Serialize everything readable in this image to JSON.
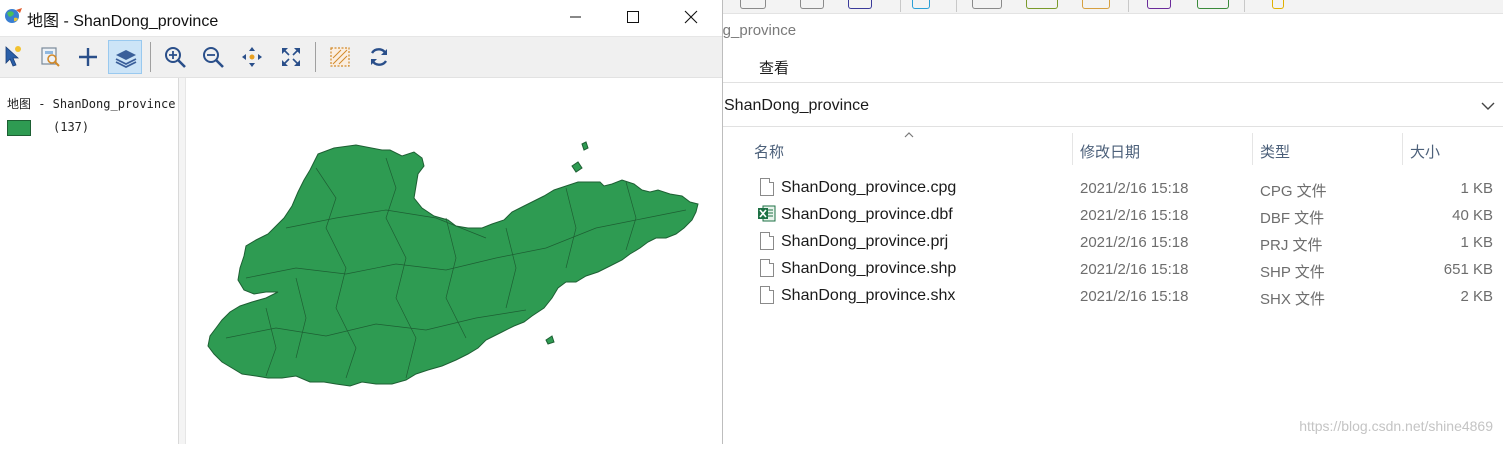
{
  "map_window": {
    "title": "地图 - ShanDong_province",
    "toolbar": [
      "select-tool",
      "identify-tool",
      "add-tool",
      "layers-tool",
      "zoom-in-tool",
      "zoom-out-tool",
      "pan-tool",
      "full-extent-tool",
      "clear-selection-tool",
      "refresh-tool"
    ],
    "legend": {
      "title": "地图 - ShanDong_province",
      "count": "(137)",
      "fill_color": "#2e9b52",
      "stroke_color": "#1d5f33"
    }
  },
  "explorer": {
    "title_fragment": "ong_province",
    "ribbon_left": ":",
    "ribbon_view": "查看",
    "address": "ShanDong_province",
    "columns": {
      "name": "名称",
      "modified": "修改日期",
      "type": "类型",
      "size": "大小"
    },
    "files": [
      {
        "name": "ShanDong_province.cpg",
        "modified": "2021/2/16 15:18",
        "type": "CPG 文件",
        "size": "1 KB",
        "icon": "file-icon"
      },
      {
        "name": "ShanDong_province.dbf",
        "modified": "2021/2/16 15:18",
        "type": "DBF 文件",
        "size": "40 KB",
        "icon": "excel-icon"
      },
      {
        "name": "ShanDong_province.prj",
        "modified": "2021/2/16 15:18",
        "type": "PRJ 文件",
        "size": "1 KB",
        "icon": "file-icon"
      },
      {
        "name": "ShanDong_province.shp",
        "modified": "2021/2/16 15:18",
        "type": "SHP 文件",
        "size": "651 KB",
        "icon": "file-icon"
      },
      {
        "name": "ShanDong_province.shx",
        "modified": "2021/2/16 15:18",
        "type": "SHX 文件",
        "size": "2 KB",
        "icon": "file-icon"
      }
    ]
  },
  "watermark": "https://blog.csdn.net/shine4869"
}
